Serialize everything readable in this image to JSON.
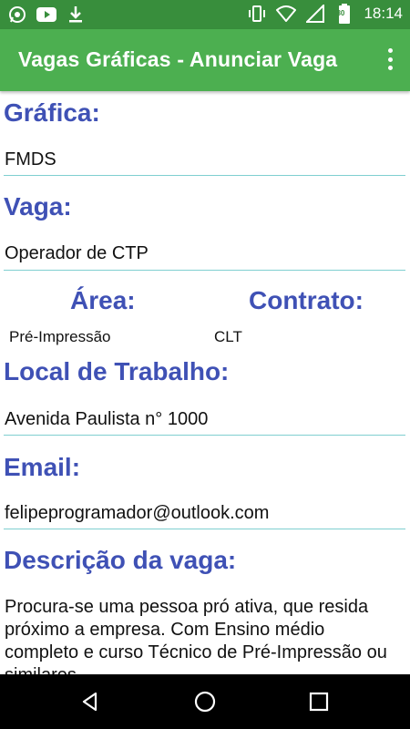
{
  "statusbar": {
    "time": "18:14",
    "left_icons": [
      "whatsapp-icon",
      "youtube-icon",
      "download-icon"
    ],
    "right_icons": [
      "vibrate-icon",
      "wifi-icon",
      "signal-icon",
      "battery-icon"
    ],
    "battery_level": "30"
  },
  "appbar": {
    "title": "Vagas Gráficas - Anunciar Vaga",
    "menu_icon": "overflow-menu-icon"
  },
  "form": {
    "grafica_label": "Gráfica:",
    "grafica_value": "FMDS",
    "vaga_label": "Vaga:",
    "vaga_value": "Operador de CTP",
    "area_label": "Área:",
    "area_value": "Pré-Impressão",
    "contrato_label": "Contrato:",
    "contrato_value": "CLT",
    "local_label": "Local de Trabalho:",
    "local_value": "Avenida Paulista n° 1000",
    "email_label": "Email:",
    "email_value": "felipeprogramador@outlook.com",
    "descricao_label": "Descrição da vaga:",
    "descricao_value": "Procura-se uma pessoa pró ativa, que resida próximo a empresa. Com Ensino médio completo e curso Técnico de Pré-Impressão ou similares."
  },
  "navbar": {
    "icons": [
      "back-icon",
      "home-icon",
      "recents-icon"
    ]
  },
  "colors": {
    "status_bar": "#388e3c",
    "app_bar": "#4caf50",
    "label": "#3f51b5",
    "underline": "#7fcfd0"
  }
}
